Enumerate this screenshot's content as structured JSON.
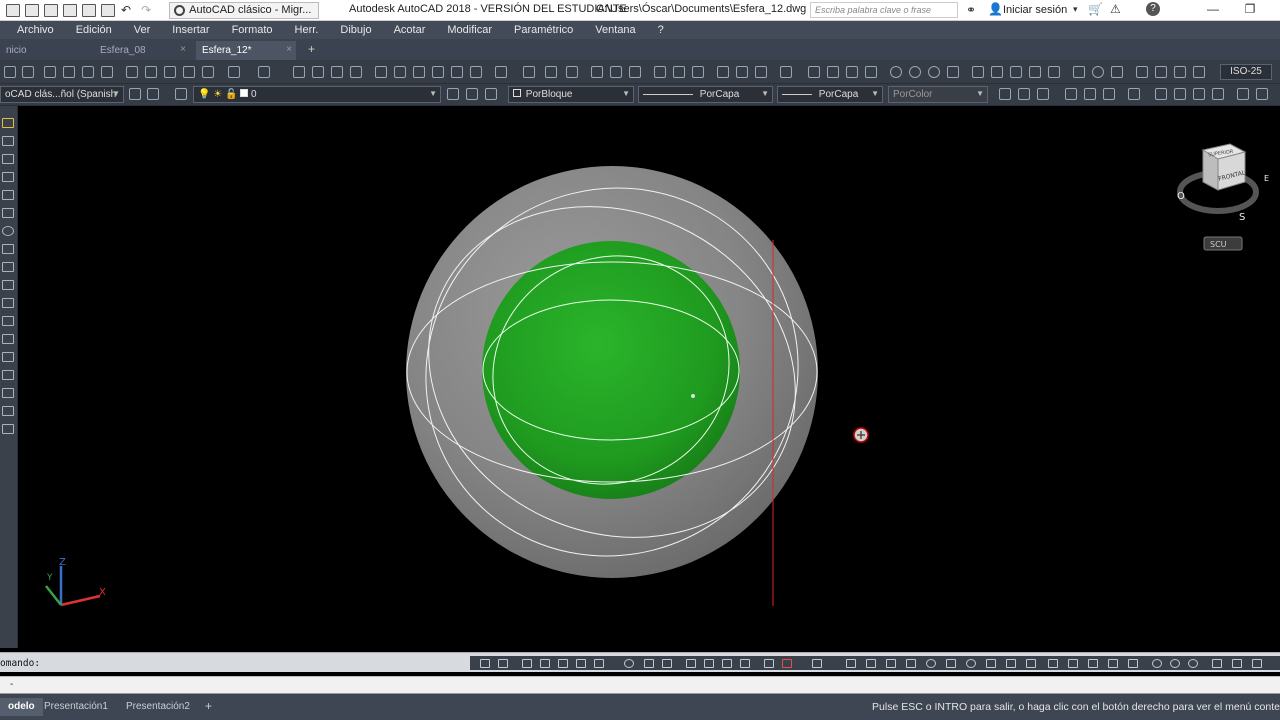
{
  "titlebar": {
    "workspace": "AutoCAD clásico - Migr...",
    "title": "Autodesk AutoCAD 2018 - VERSIÓN DEL ESTUDIANTE",
    "path": "C:\\Users\\Óscar\\Documents\\Esfera_12.dwg",
    "search_placeholder": "Escriba palabra clave o frase",
    "signin": "Iniciar sesión",
    "minimize": "—",
    "restore": "❐"
  },
  "menu": [
    "Archivo",
    "Edición",
    "Ver",
    "Insertar",
    "Formato",
    "Herr.",
    "Dibujo",
    "Acotar",
    "Modificar",
    "Paramétrico",
    "Ventana",
    "?"
  ],
  "file_tabs": [
    {
      "label": "nicio",
      "close": ""
    },
    {
      "label": "Esfera_08",
      "close": "×"
    },
    {
      "label": "Esfera_12*",
      "close": "×",
      "active": true
    }
  ],
  "new_tab": "+",
  "toolbar2": {
    "textstyle": "oCAD clás...ñol (Spanish",
    "layer": "0",
    "color": "PorBloque",
    "linetype": "PorCapa",
    "lineweight": "PorCapa",
    "plotstyle": "PorColor"
  },
  "dimstyle": "ISO-25",
  "viewcube": {
    "top_face": "SUPERIOR",
    "front_face": "FRONTAL",
    "compass_o": "O",
    "compass_s": "S",
    "compass_e": "E",
    "ucs_label": "SCU"
  },
  "ucs": {
    "x": "X",
    "y": "Y",
    "z": "Z"
  },
  "command": {
    "label": "omando:",
    "prompt": "-"
  },
  "layout_tabs": [
    {
      "label": "odelo",
      "active": true
    },
    {
      "label": "Presentación1"
    },
    {
      "label": "Presentación2"
    }
  ],
  "add_layout": "+",
  "status_message": "Pulse ESC o INTRO para salir, o haga clic con el botón derecho para ver el menú conte",
  "colors": {
    "outer_sphere": "#8a8a8a",
    "inner_sphere": "#1fa21f",
    "section_line": "#e22222",
    "viewport_bg": "#000000",
    "menubar": "#424b57"
  }
}
